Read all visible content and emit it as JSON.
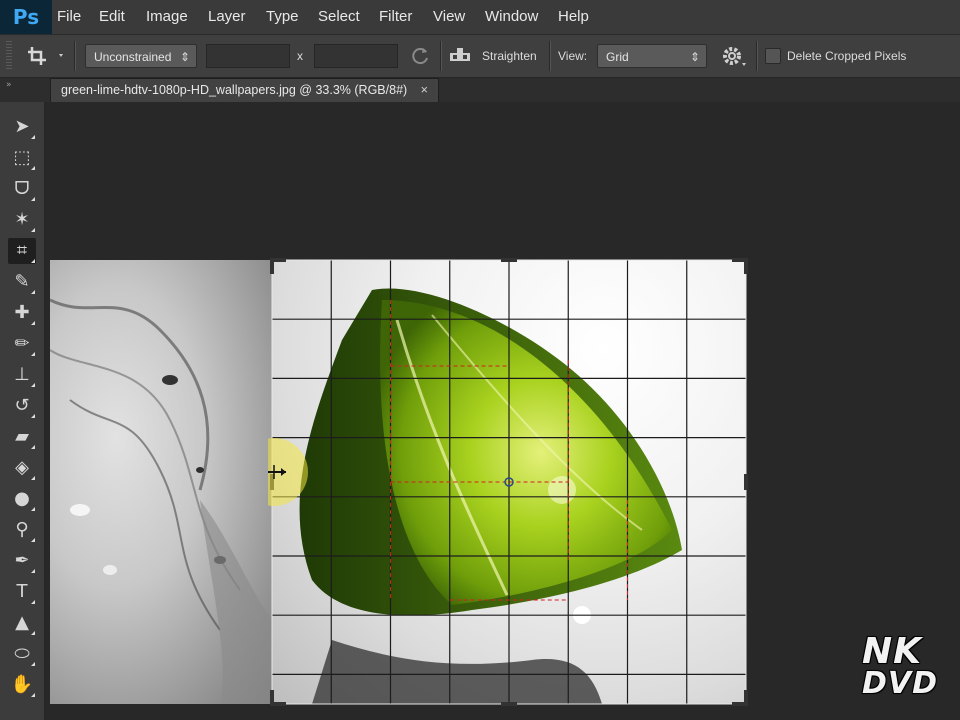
{
  "app": {
    "logo": "Ps",
    "accent": "#3fa9f5"
  },
  "menu": {
    "items": [
      "File",
      "Edit",
      "Image",
      "Layer",
      "Type",
      "Select",
      "Filter",
      "View",
      "Window",
      "Help"
    ]
  },
  "options": {
    "ratio": "Unconstrained",
    "width_value": "",
    "times": "x",
    "height_value": "",
    "straighten": "Straighten",
    "view_label": "View:",
    "view_value": "Grid",
    "delete_cropped": "Delete Cropped Pixels",
    "delete_cropped_checked": false
  },
  "document": {
    "tab_title": "green-lime-hdtv-1080p-HD_wallpapers.jpg @ 33.3% (RGB/8#)",
    "close_glyph": "×"
  },
  "toolbar": {
    "tools": [
      {
        "name": "move-tool",
        "icon": "move-icon",
        "glyph": "➤"
      },
      {
        "name": "marquee-tool",
        "icon": "rectangular-marquee-icon",
        "glyph": "⬚"
      },
      {
        "name": "lasso-tool",
        "icon": "lasso-icon",
        "glyph": "ᗜ"
      },
      {
        "name": "quick-selection-tool",
        "icon": "magic-wand-icon",
        "glyph": "✶"
      },
      {
        "name": "crop-tool",
        "icon": "crop-icon",
        "glyph": "⌗",
        "active": true
      },
      {
        "name": "eyedropper-tool",
        "icon": "eyedropper-icon",
        "glyph": "✎"
      },
      {
        "name": "healing-brush-tool",
        "icon": "bandage-icon",
        "glyph": "✚"
      },
      {
        "name": "brush-tool",
        "icon": "brush-icon",
        "glyph": "✏"
      },
      {
        "name": "clone-stamp-tool",
        "icon": "stamp-icon",
        "glyph": "⊥"
      },
      {
        "name": "history-brush-tool",
        "icon": "history-brush-icon",
        "glyph": "↺"
      },
      {
        "name": "eraser-tool",
        "icon": "eraser-icon",
        "glyph": "▰"
      },
      {
        "name": "paint-bucket-tool",
        "icon": "paint-bucket-icon",
        "glyph": "◈"
      },
      {
        "name": "blur-tool",
        "icon": "blur-drop-icon",
        "glyph": "●"
      },
      {
        "name": "dodge-tool",
        "icon": "dodge-icon",
        "glyph": "⚲"
      },
      {
        "name": "pen-tool",
        "icon": "pen-icon",
        "glyph": "✒"
      },
      {
        "name": "type-tool",
        "icon": "type-icon",
        "glyph": "T"
      },
      {
        "name": "path-selection-tool",
        "icon": "path-selection-icon",
        "glyph": "▲"
      },
      {
        "name": "shape-tool",
        "icon": "shape-icon",
        "glyph": "⬭"
      },
      {
        "name": "hand-tool",
        "icon": "hand-icon",
        "glyph": "✋"
      }
    ]
  },
  "crop": {
    "grid_color": "#1c1c1c",
    "guide_color": "#d02020",
    "highlight_color": "#f2e640"
  },
  "watermark": {
    "line1": "NK",
    "line2": "DVD"
  }
}
